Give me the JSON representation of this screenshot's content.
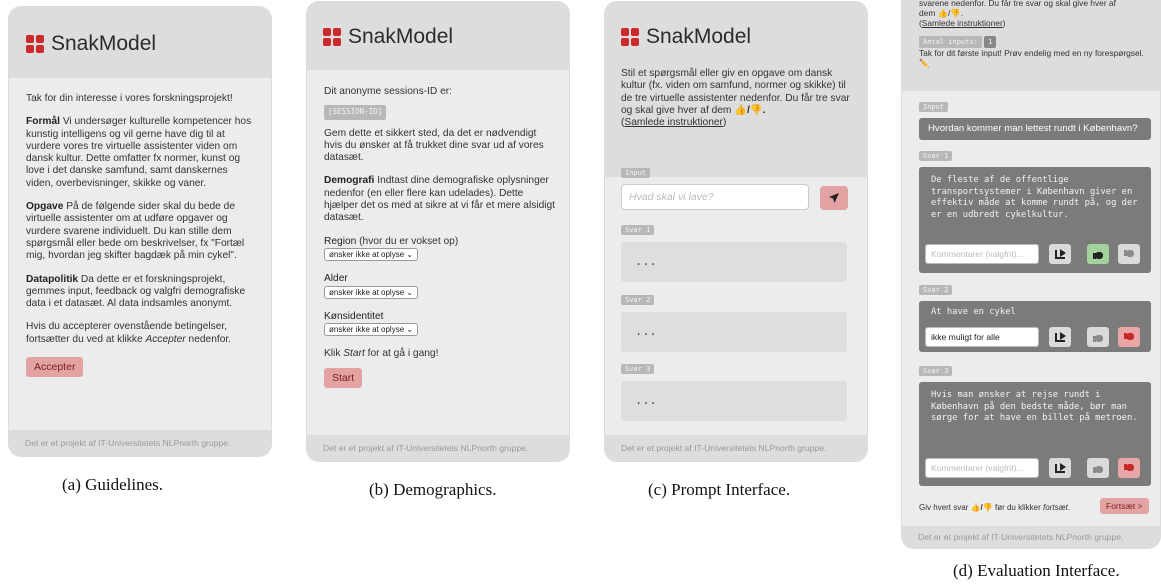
{
  "brand": {
    "name": "SnakModel"
  },
  "footer_text": "Det er et projekt af IT-Universitetets NLPnorth gruppe.",
  "captions": {
    "a": "(a) Guidelines.",
    "b": "(b) Demographics.",
    "c": "(c) Prompt Interface.",
    "d": "(d) Evaluation Interface."
  },
  "guidelines": {
    "intro": "Tak for din interesse i vores forskningsprojekt!",
    "purpose_label": "Formål",
    "purpose_text": "Vi undersøger kulturelle kompetencer hos kunstig intelligens og vil gerne have dig til at vurdere vores tre virtuelle assistenter viden om dansk kultur. Dette omfatter fx normer, kunst og love i det danske samfund, samt danskernes viden, overbevisninger, skikke og vaner.",
    "task_label": "Opgave",
    "task_text": "På de følgende sider skal du bede de virtuelle assistenter om at udføre opgaver og vurdere svarene individuelt. Du kan stille dem spørgsmål eller bede om beskrivelser, fx \"Fortæl mig, hvordan jeg skifter bagdæk på min cykel\".",
    "policy_label": "Datapolitik",
    "policy_text": "Da dette er et forskningsprojekt, gemmes input, feedback og valgfri demografiske data i et datasæt. Al data indsamles anonymt.",
    "accept_prefix": "Hvis du accepterer ovenstående betingelser, fortsætter du ved at klikke",
    "accept_word": "Accepter",
    "accept_suffix": "nedenfor.",
    "accept_button": "Accepter"
  },
  "demographics": {
    "session_intro": "Dit anonyme sessions-ID er:",
    "session_id": "[SESSION-ID]",
    "save_text": "Gem dette et sikkert sted, da det er nødvendigt hvis du ønsker at få trukket dine svar ud af vores datasæt.",
    "demo_label": "Demografi",
    "demo_text": "Indtast dine demografiske oplysninger nedenfor (en eller flere kan udelades). Dette hjælper det os med at sikre at vi får et mere alsidigt datasæt.",
    "region_label": "Region",
    "region_hint": "(hvor du er vokset op)",
    "age_label": "Alder",
    "gender_label": "Kønsidentitet",
    "select_value": "ønsker ikke at oplyse",
    "start_prefix": "Klik",
    "start_word": "Start",
    "start_suffix": "for at gå i gang!",
    "start_button": "Start"
  },
  "prompt": {
    "description": "Stil et spørgsmål eller giv en opgave om dansk kultur (fx. viden om samfund, normer og skikke) til de tre virtuelle assistenter nedenfor. Du får tre svar og skal give hver af dem",
    "vote_symbol": "👍/👎.",
    "guidelines_link": "Samlede instruktioner",
    "input_tag": "Input",
    "input_placeholder": "Hvad skal vi lave?",
    "answer_tags": [
      "Svar 1",
      "Svar 2",
      "Svar 3"
    ],
    "pending": "..."
  },
  "evaluation": {
    "top_line1": "svarene nedenfor. Du får tre svar og skal give hver af",
    "top_line2": "dem 👍/👎.",
    "guidelines_link": "Samlede instruktioner",
    "count_label": "Antal inputs:",
    "count_value": "1",
    "thanks": "Tak for dit første input! Prøv endelig med en ny forespørgsel. ✏️",
    "input_tag": "Input",
    "question": "Hvordan kommer man lettest rundt i København?",
    "answers": [
      {
        "tag": "Svar 1",
        "text": "De fleste af de offentlige transportsystemer i København giver en effektiv måde at komme rundt på, og der er en udbredt cykelkultur.",
        "comment": "",
        "vote": "up"
      },
      {
        "tag": "Svar 2",
        "text": "At have en cykel",
        "comment": "ikke muligt for alle",
        "vote": "down"
      },
      {
        "tag": "Svar 3",
        "text": "Hvis man ønsker at rejse rundt i København på den bedste måde, bør man sørge for at have en billet på metroen.",
        "comment": "",
        "vote": "down"
      }
    ],
    "comment_placeholder": "Kommentarer (valgfrit)...",
    "bottom_prefix": "Giv hvert svar",
    "bottom_vote": "👍/👎",
    "bottom_mid": "før du klikker",
    "bottom_word": "fortsæt",
    "continue_button": "Fortsæt >"
  }
}
